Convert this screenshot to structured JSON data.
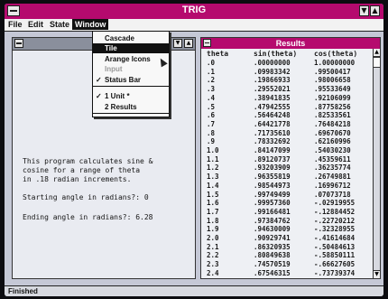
{
  "app": {
    "title": "TRIG"
  },
  "menubar": {
    "items": [
      "File",
      "Edit",
      "State",
      "Window"
    ]
  },
  "window_menu": {
    "items": [
      {
        "label": "Cascade",
        "checked": false,
        "selected": false,
        "disabled": false
      },
      {
        "label": "Tile",
        "checked": false,
        "selected": true,
        "disabled": false
      },
      {
        "label": "Arange Icons",
        "checked": false,
        "selected": false,
        "disabled": false
      },
      {
        "label": "Input",
        "checked": false,
        "selected": false,
        "disabled": true
      },
      {
        "label": "Status Bar",
        "checked": true,
        "selected": false,
        "disabled": false
      },
      {
        "label": "1 Unit *",
        "checked": true,
        "selected": false,
        "disabled": false
      },
      {
        "label": "2 Results",
        "checked": false,
        "selected": false,
        "disabled": false
      }
    ]
  },
  "program": {
    "description": "This program calculates sine &\ncosine for a range of theta\nin .18 radian increments.",
    "start_prompt": "Starting angle in radians?: 0",
    "end_prompt": "Ending angle in radians?: 6.28"
  },
  "results": {
    "title": "Results",
    "columns": [
      "theta",
      "sin(theta)",
      "cos(theta)"
    ],
    "rows": [
      [
        ".0",
        ".00000000",
        "1.00000000"
      ],
      [
        ".1",
        ".09983342",
        ".99500417"
      ],
      [
        ".2",
        ".19866933",
        ".98006658"
      ],
      [
        ".3",
        ".29552021",
        ".95533649"
      ],
      [
        ".4",
        ".38941835",
        ".92106099"
      ],
      [
        ".5",
        ".47942555",
        ".87758256"
      ],
      [
        ".6",
        ".56464248",
        ".82533561"
      ],
      [
        ".7",
        ".64421778",
        ".76484218"
      ],
      [
        ".8",
        ".71735610",
        ".69670670"
      ],
      [
        ".9",
        ".78332692",
        ".62160996"
      ],
      [
        "1.0",
        ".84147099",
        ".54030230"
      ],
      [
        "1.1",
        ".89120737",
        ".45359611"
      ],
      [
        "1.2",
        ".93203909",
        ".36235774"
      ],
      [
        "1.3",
        ".96355819",
        ".26749881"
      ],
      [
        "1.4",
        ".98544973",
        ".16996712"
      ],
      [
        "1.5",
        ".99749499",
        ".07073718"
      ],
      [
        "1.6",
        ".99957360",
        "-.02919955"
      ],
      [
        "1.7",
        ".99166481",
        "-.12884452"
      ],
      [
        "1.8",
        ".97384762",
        "-.22720212"
      ],
      [
        "1.9",
        ".94630009",
        "-.32328955"
      ],
      [
        "2.0",
        ".90929741",
        "-.41614684"
      ],
      [
        "2.1",
        ".86320935",
        "-.50484613"
      ],
      [
        "2.2",
        ".80849638",
        "-.58850111"
      ],
      [
        "2.3",
        ".74570519",
        "-.66627605"
      ],
      [
        "2.4",
        ".67546315",
        "-.73739374"
      ]
    ]
  },
  "status": {
    "text": "Finished"
  },
  "colors": {
    "accent": "#b50a6e",
    "desktop": "#c5c8d6"
  }
}
